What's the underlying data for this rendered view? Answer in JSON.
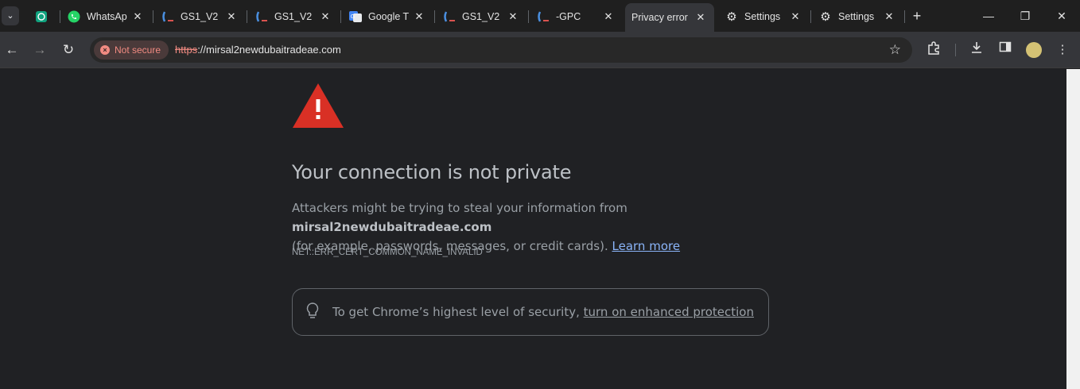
{
  "tabs": [
    {
      "title": "",
      "icon": "chatgpt-icon",
      "active": false
    },
    {
      "title": "WhatsAp",
      "icon": "whatsapp-icon",
      "active": false
    },
    {
      "title": "GS1_V2",
      "icon": "gs1-icon",
      "active": false
    },
    {
      "title": "GS1_V2",
      "icon": "gs1-icon",
      "active": false
    },
    {
      "title": "Google T",
      "icon": "google-translate-icon",
      "active": false
    },
    {
      "title": "GS1_V2",
      "icon": "gs1-icon",
      "active": false
    },
    {
      "title": "-GPC",
      "icon": "gs1-icon",
      "active": false
    },
    {
      "title": "Privacy error",
      "icon": "",
      "active": true
    },
    {
      "title": "Settings",
      "icon": "gear-icon",
      "active": false
    },
    {
      "title": "Settings",
      "icon": "gear-icon",
      "active": false
    }
  ],
  "omnibox": {
    "security_label": "Not secure",
    "url_scheme": "https",
    "url_rest": "://mirsal2newdubaitradeae.com"
  },
  "error_page": {
    "heading": "Your connection is not private",
    "para_prefix": "Attackers might be trying to steal your information from ",
    "domain": "mirsal2newdubaitradeae.com",
    "para_suffix": "(for example, passwords, messages, or credit cards). ",
    "learn_more": "Learn more",
    "error_code": "NET::ERR_CERT_COMMON_NAME_INVALID",
    "enhanced_prefix": "To get Chrome’s highest level of security, ",
    "enhanced_link": "turn on enhanced protection"
  },
  "colors": {
    "warning_red": "#d93025",
    "link_blue": "#8ab4f8",
    "page_bg": "#202124"
  }
}
